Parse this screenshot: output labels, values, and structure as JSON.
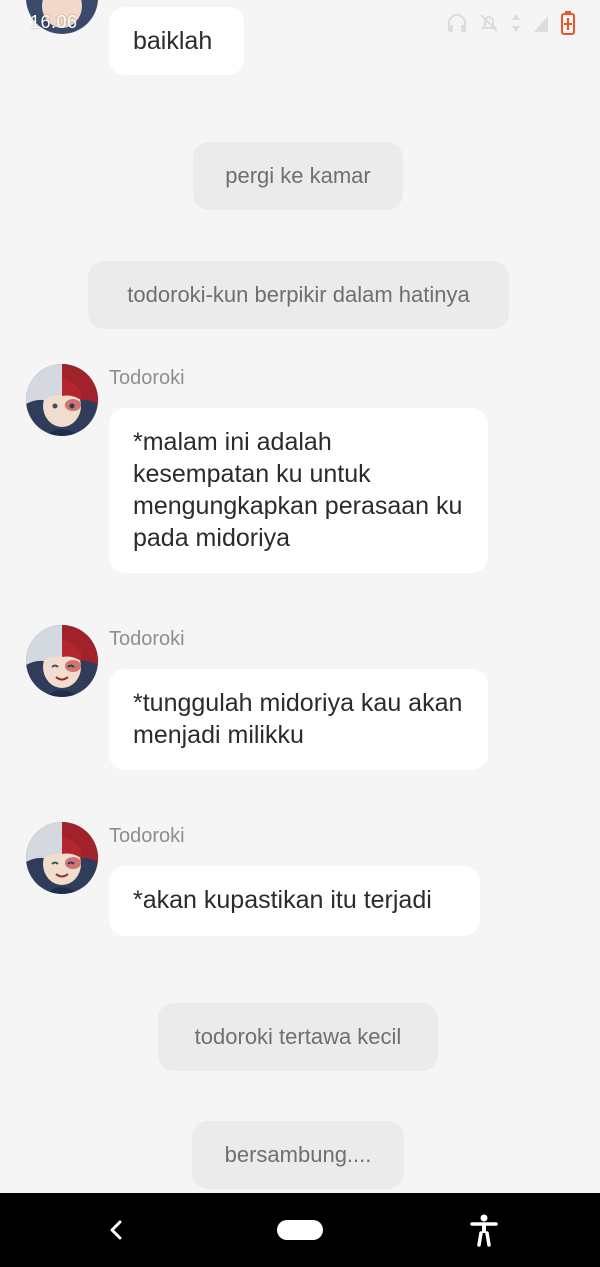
{
  "status_bar": {
    "time": "16.06",
    "icons": [
      "headphones-icon",
      "bell-off-icon",
      "data-arrows-icon",
      "signal-icon",
      "battery-charging-icon"
    ],
    "battery_color": "#e8542b"
  },
  "messages": [
    {
      "type": "bubble",
      "text": "baiklah"
    },
    {
      "type": "narration",
      "text": "pergi ke kamar"
    },
    {
      "type": "narration",
      "text": "todoroki-kun berpikir dalam hatinya"
    },
    {
      "type": "character",
      "sender": "Todoroki",
      "text": "*malam ini adalah kesempatan ku untuk mengungkapkan perasaan ku pada midoriya"
    },
    {
      "type": "character",
      "sender": "Todoroki",
      "text": "*tunggulah midoriya kau akan menjadi milikku"
    },
    {
      "type": "character",
      "sender": "Todoroki",
      "text": "*akan kupastikan itu terjadi"
    },
    {
      "type": "narration",
      "text": "todoroki tertawa kecil"
    },
    {
      "type": "narration",
      "text": "bersambung...."
    }
  ],
  "nav_bar": {
    "icons": [
      "back-icon",
      "home-pill-icon",
      "accessibility-icon"
    ]
  },
  "colors": {
    "background": "#f5f5f5",
    "bubble": "#ffffff",
    "narration": "#ebebeb",
    "nav": "#000000"
  }
}
